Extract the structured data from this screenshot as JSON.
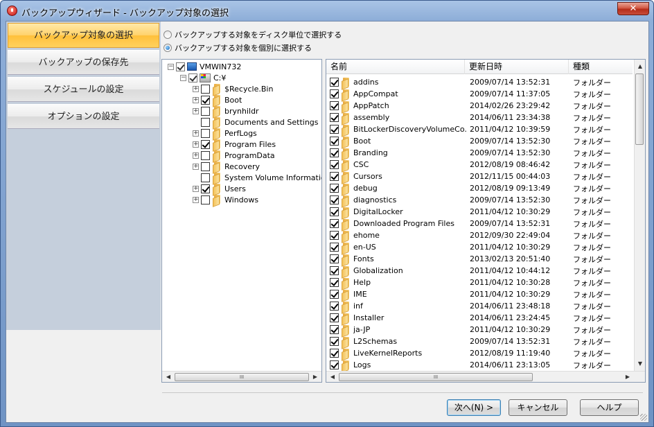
{
  "window": {
    "title": "バックアップウィザード - バックアップ対象の選択",
    "close_label": "✕"
  },
  "sidebar": {
    "items": [
      {
        "label": "バックアップ対象の選択",
        "active": true
      },
      {
        "label": "バックアップの保存先",
        "active": false
      },
      {
        "label": "スケジュールの設定",
        "active": false
      },
      {
        "label": "オプションの設定",
        "active": false
      }
    ]
  },
  "options": {
    "disk_label": "バックアップする対象をディスク単位で選択する",
    "individual_label": "バックアップする対象を個別に選択する",
    "selected": "individual"
  },
  "tree": {
    "root": "VMWIN732",
    "drive": "C:¥",
    "items": [
      {
        "label": "$Recycle.Bin",
        "checked": false,
        "expandable": true
      },
      {
        "label": "Boot",
        "checked": true,
        "expandable": true
      },
      {
        "label": "brynhildr",
        "checked": false,
        "expandable": true
      },
      {
        "label": "Documents and Settings",
        "checked": false,
        "expandable": false
      },
      {
        "label": "PerfLogs",
        "checked": false,
        "expandable": true
      },
      {
        "label": "Program Files",
        "checked": true,
        "expandable": true
      },
      {
        "label": "ProgramData",
        "checked": false,
        "expandable": true
      },
      {
        "label": "Recovery",
        "checked": false,
        "expandable": true
      },
      {
        "label": "System Volume Information",
        "checked": false,
        "expandable": false
      },
      {
        "label": "Users",
        "checked": true,
        "expandable": true
      },
      {
        "label": "Windows",
        "checked": false,
        "expandable": true
      }
    ],
    "scroll_glyph": "III"
  },
  "list": {
    "columns": {
      "name": "名前",
      "date": "更新日時",
      "type": "種類"
    },
    "rows": [
      {
        "name": "addins",
        "date": "2009/07/14 13:52:31",
        "type": "フォルダー"
      },
      {
        "name": "AppCompat",
        "date": "2009/07/14 11:37:05",
        "type": "フォルダー"
      },
      {
        "name": "AppPatch",
        "date": "2014/02/26 23:29:42",
        "type": "フォルダー"
      },
      {
        "name": "assembly",
        "date": "2014/06/11 23:34:38",
        "type": "フォルダー"
      },
      {
        "name": "BitLockerDiscoveryVolumeCo...",
        "date": "2011/04/12 10:39:59",
        "type": "フォルダー"
      },
      {
        "name": "Boot",
        "date": "2009/07/14 13:52:30",
        "type": "フォルダー"
      },
      {
        "name": "Branding",
        "date": "2009/07/14 13:52:30",
        "type": "フォルダー"
      },
      {
        "name": "CSC",
        "date": "2012/08/19 08:46:42",
        "type": "フォルダー"
      },
      {
        "name": "Cursors",
        "date": "2012/11/15 00:44:03",
        "type": "フォルダー"
      },
      {
        "name": "debug",
        "date": "2012/08/19 09:13:49",
        "type": "フォルダー"
      },
      {
        "name": "diagnostics",
        "date": "2009/07/14 13:52:30",
        "type": "フォルダー"
      },
      {
        "name": "DigitalLocker",
        "date": "2011/04/12 10:30:29",
        "type": "フォルダー"
      },
      {
        "name": "Downloaded Program Files",
        "date": "2009/07/14 13:52:31",
        "type": "フォルダー"
      },
      {
        "name": "ehome",
        "date": "2012/09/30 22:49:04",
        "type": "フォルダー"
      },
      {
        "name": "en-US",
        "date": "2011/04/12 10:30:29",
        "type": "フォルダー"
      },
      {
        "name": "Fonts",
        "date": "2013/02/13 20:51:40",
        "type": "フォルダー"
      },
      {
        "name": "Globalization",
        "date": "2011/04/12 10:44:12",
        "type": "フォルダー"
      },
      {
        "name": "Help",
        "date": "2011/04/12 10:30:28",
        "type": "フォルダー"
      },
      {
        "name": "IME",
        "date": "2011/04/12 10:30:29",
        "type": "フォルダー"
      },
      {
        "name": "inf",
        "date": "2014/06/11 23:48:18",
        "type": "フォルダー"
      },
      {
        "name": "Installer",
        "date": "2014/06/11 23:24:45",
        "type": "フォルダー"
      },
      {
        "name": "ja-JP",
        "date": "2011/04/12 10:30:29",
        "type": "フォルダー"
      },
      {
        "name": "L2Schemas",
        "date": "2009/07/14 13:52:31",
        "type": "フォルダー"
      },
      {
        "name": "LiveKernelReports",
        "date": "2012/08/19 11:19:40",
        "type": "フォルダー"
      },
      {
        "name": "Logs",
        "date": "2014/06/11 23:13:05",
        "type": "フォルダー"
      }
    ]
  },
  "buttons": {
    "next": "次へ(N) >",
    "cancel": "キャンセル",
    "help": "ヘルプ"
  }
}
